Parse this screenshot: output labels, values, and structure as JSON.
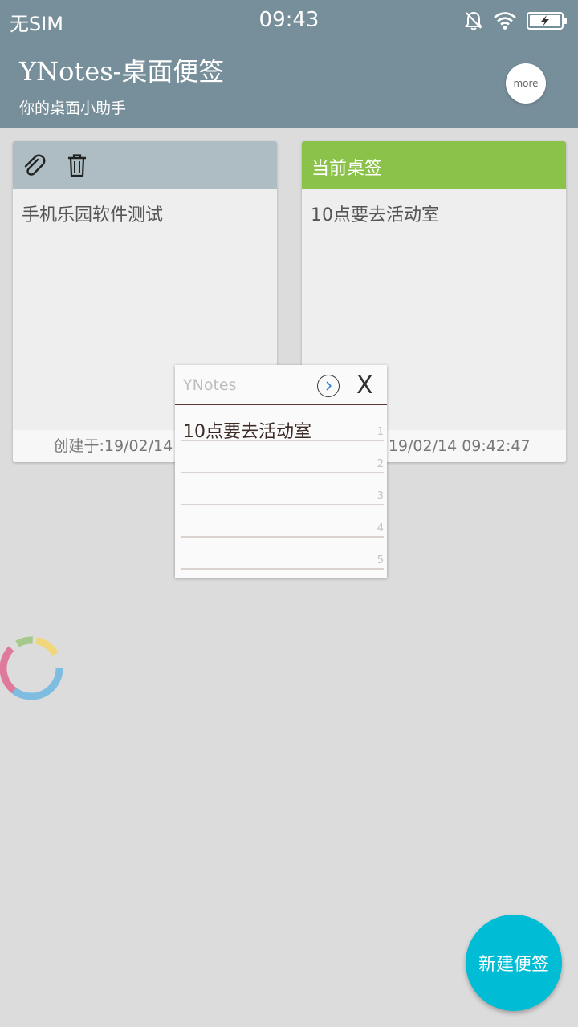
{
  "status_bar": {
    "carrier": "无SIM",
    "time": "09:43"
  },
  "app": {
    "title": "YNotes-桌面便签",
    "subtitle": "你的桌面小助手",
    "more_label": "more"
  },
  "cards": [
    {
      "header_label": "",
      "body": "手机乐园软件测试",
      "footer": "创建于:19/02/14 09:42:4"
    },
    {
      "header_label": "当前桌签",
      "body": "10点要去活动室",
      "footer": "创建于:19/02/14 09:42:47"
    }
  ],
  "widget": {
    "title": "YNotes",
    "close_label": "X",
    "text": "10点要去活动室",
    "line_numbers": [
      "1",
      "2",
      "3",
      "4",
      "5"
    ]
  },
  "fab": {
    "label": "新建便签"
  },
  "colors": {
    "header": "#778f9b",
    "card_left_header": "#adbdc3",
    "card_right_header": "#8bc34a",
    "fab": "#00bcd4"
  },
  "icons": [
    "bell-off-icon",
    "wifi-icon",
    "battery-icon",
    "paperclip-icon",
    "trash-icon",
    "arrow-right-icon"
  ]
}
